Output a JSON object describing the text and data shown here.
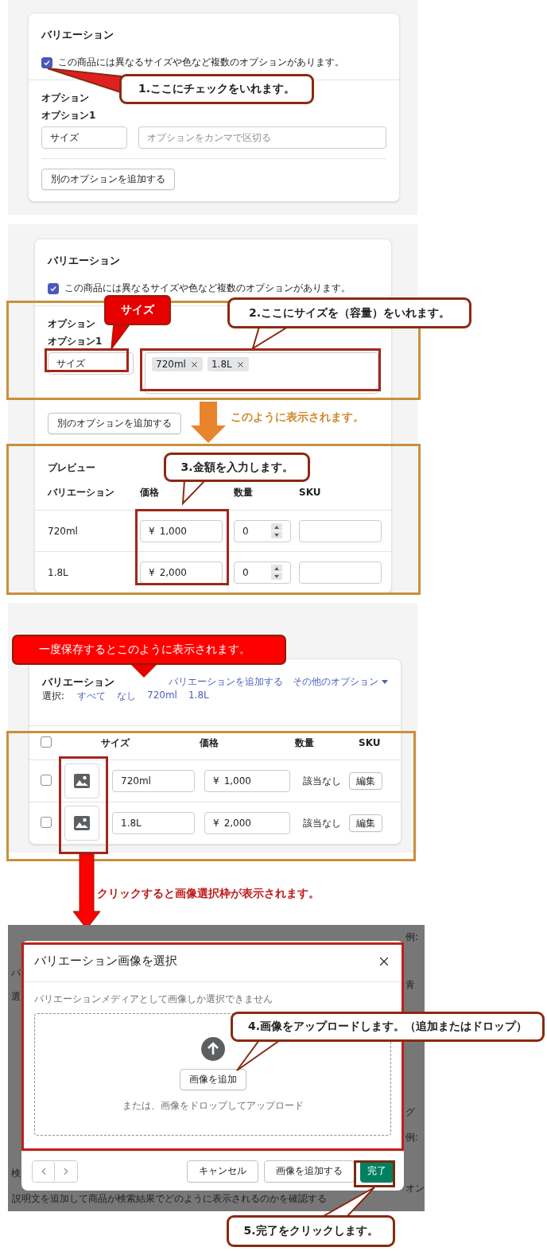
{
  "step1": {
    "card_title": "バリエーション",
    "has_options": {
      "label": "この商品には異なるサイズや色など複数のオプションがあります。",
      "checked": true
    },
    "options_label": "オプション",
    "option_name_label": "オプション1",
    "option_name_value": "サイズ",
    "option_values_placeholder": "オプションをカンマで区切る",
    "add_option_button": "別のオプションを追加する",
    "callout": "1.ここにチェックをいれます。"
  },
  "step2": {
    "card_title": "バリエーション",
    "has_options": {
      "label": "この商品には異なるサイズや色など複数のオプションがあります。",
      "checked": true
    },
    "options_label": "オプション",
    "option_name_label": "オプション1",
    "option_name_value": "サイズ",
    "tags": [
      "720ml",
      "1.8L"
    ],
    "add_option_button": "別のオプションを追加する",
    "size_callout": "サイズ",
    "callout": "2.ここにサイズを（容量）をいれます。",
    "result_note": "このように表示されます。",
    "preview_label": "プレビュー",
    "columns": [
      "バリエーション",
      "価格",
      "数量",
      "SKU"
    ],
    "rows": [
      {
        "name": "720ml",
        "currency": "¥",
        "price": "1,000",
        "quantity": "0"
      },
      {
        "name": "1.8L",
        "currency": "¥",
        "price": "2,000",
        "quantity": "0"
      }
    ],
    "price_callout": "3.金額を入力します。"
  },
  "step3": {
    "banner": "一度保存するとこのように表示されます。",
    "card_title": "バリエーション",
    "actions": [
      {
        "label": "バリエーションを追加する",
        "kind": "link"
      },
      {
        "label": "その他のオプション",
        "kind": "menu"
      }
    ],
    "select_label": "選択:",
    "select_links": [
      "すべて",
      "なし",
      "720ml",
      "1.8L"
    ],
    "header_checked": false,
    "columns": [
      "サイズ",
      "価格",
      "数量",
      "SKU"
    ],
    "rows": [
      {
        "checked": false,
        "size": "720ml",
        "currency": "¥",
        "price": "1,000",
        "quantity": "該当なし",
        "edit": "編集"
      },
      {
        "checked": false,
        "size": "1.8L",
        "currency": "¥",
        "price": "2,000",
        "quantity": "該当なし",
        "edit": "編集"
      }
    ],
    "note": "クリックすると画像選択枠が表示されます。"
  },
  "step4": {
    "modal_title": "バリエーション画像を選択",
    "subtitle": "バリエーションメディアとして画像しか選択できません",
    "add_image_button": "画像を追加",
    "drop_hint": "または、画像をドロップしてアップロード",
    "callout": "4.画像をアップロードします。（追加またはドロップ）",
    "buttons": [
      {
        "label": "キャンセル",
        "kind": "default"
      },
      {
        "label": "画像を追加する",
        "kind": "default"
      },
      {
        "label": "完了",
        "kind": "primary"
      }
    ],
    "done_callout": "5.完了をクリックします。",
    "backdrop": {
      "left": [
        "バ",
        "選",
        "検"
      ],
      "right": [
        "例:",
        "青",
        "グ",
        "例:",
        "オン"
      ],
      "description": "説明文を追加して商品が検索結果でどのように表示されるのかを確認する"
    }
  }
}
